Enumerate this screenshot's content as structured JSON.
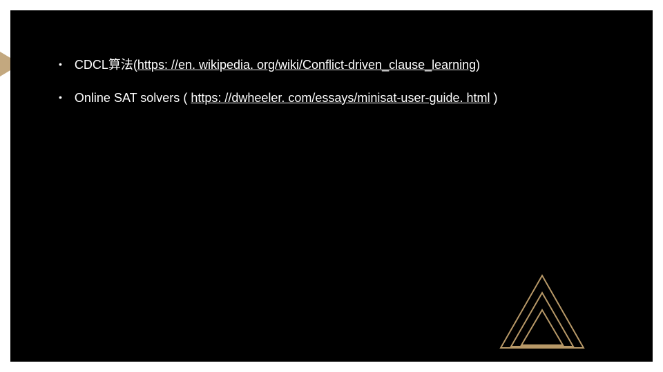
{
  "bullets": [
    {
      "label": "CDCL算法",
      "paren_open": "(",
      "link": "https: //en. wikipedia. org/wiki/Conflict-driven_clause_learning",
      "paren_close": ")"
    },
    {
      "label": "Online SAT solvers",
      "paren_open": " ( ",
      "link": "https: //dwheeler. com/essays/minisat-user-guide. html",
      "paren_close": " )"
    }
  ],
  "colors": {
    "accent": "#b89968",
    "background": "#000000",
    "text": "#ffffff"
  }
}
